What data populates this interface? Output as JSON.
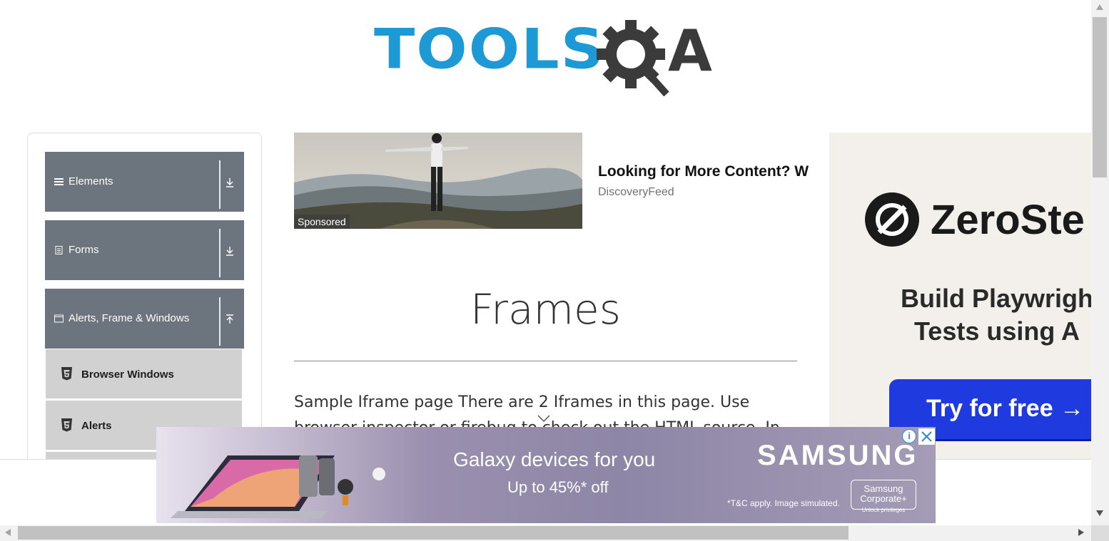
{
  "header": {
    "logo_tools": "TOOLS",
    "logo_a": "A",
    "logo_name": "tools-qa-logo"
  },
  "sidebar": {
    "groups": [
      {
        "label": "Elements",
        "icon": "hamburger-icon",
        "arrow": "download-arrow-icon"
      },
      {
        "label": "Forms",
        "icon": "form-document-icon",
        "arrow": "download-arrow-icon"
      },
      {
        "label": "Alerts, Frame & Windows",
        "icon": "window-icon",
        "arrow": "upload-arrow-icon"
      }
    ],
    "items": [
      {
        "label": "Browser Windows",
        "icon": "html5-icon"
      },
      {
        "label": "Alerts",
        "icon": "html5-icon"
      }
    ]
  },
  "sponsored_ad": {
    "tag": "Sponsored",
    "headline": "Looking for More Content? W",
    "source": "DiscoveryFeed"
  },
  "main": {
    "title": "Frames",
    "intro": "Sample Iframe page There are 2 Iframes in this page. Use browser inspector or firebug to check out the HTML source. In total you"
  },
  "right_ad": {
    "brand": "ZeroSte",
    "tagline": "Build Playwrigh\nTests using A",
    "cta": "Try for free →"
  },
  "bottom_ad": {
    "headline": "Galaxy devices for you",
    "sub": "Up to 45%* off",
    "brand": "SAMSUNG",
    "fine_print": "*T&C apply. Image simulated.",
    "corporate": "Samsung Corporate+",
    "corporate_sub": "Unlock privileges",
    "info": "i"
  },
  "colors": {
    "logo_blue": "#1d9ad6",
    "logo_dark": "#3b3b3b",
    "nav_group_bg": "#6c757d",
    "nav_item_bg": "#d1d1d1",
    "cta_blue": "#1f3be0"
  }
}
